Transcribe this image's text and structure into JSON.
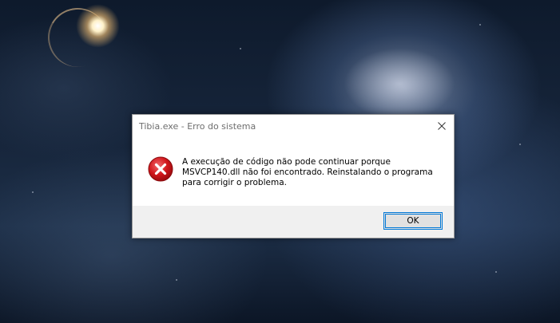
{
  "wallpaper": {
    "description_icon": "galaxy-wallpaper"
  },
  "dialog": {
    "title": "Tibia.exe - Erro do sistema",
    "close_icon": "close-icon",
    "error_icon": "error-icon",
    "message_lines": [
      "A execução de código não pode continuar porque",
      "MSVCP140.dll não foi encontrado. Reinstalando o programa",
      "para corrigir o problema."
    ],
    "ok_label": "OK",
    "colors": {
      "accent": "#0078d7",
      "error_red": "#d0161b",
      "footer_bg": "#f0f0f0"
    }
  }
}
